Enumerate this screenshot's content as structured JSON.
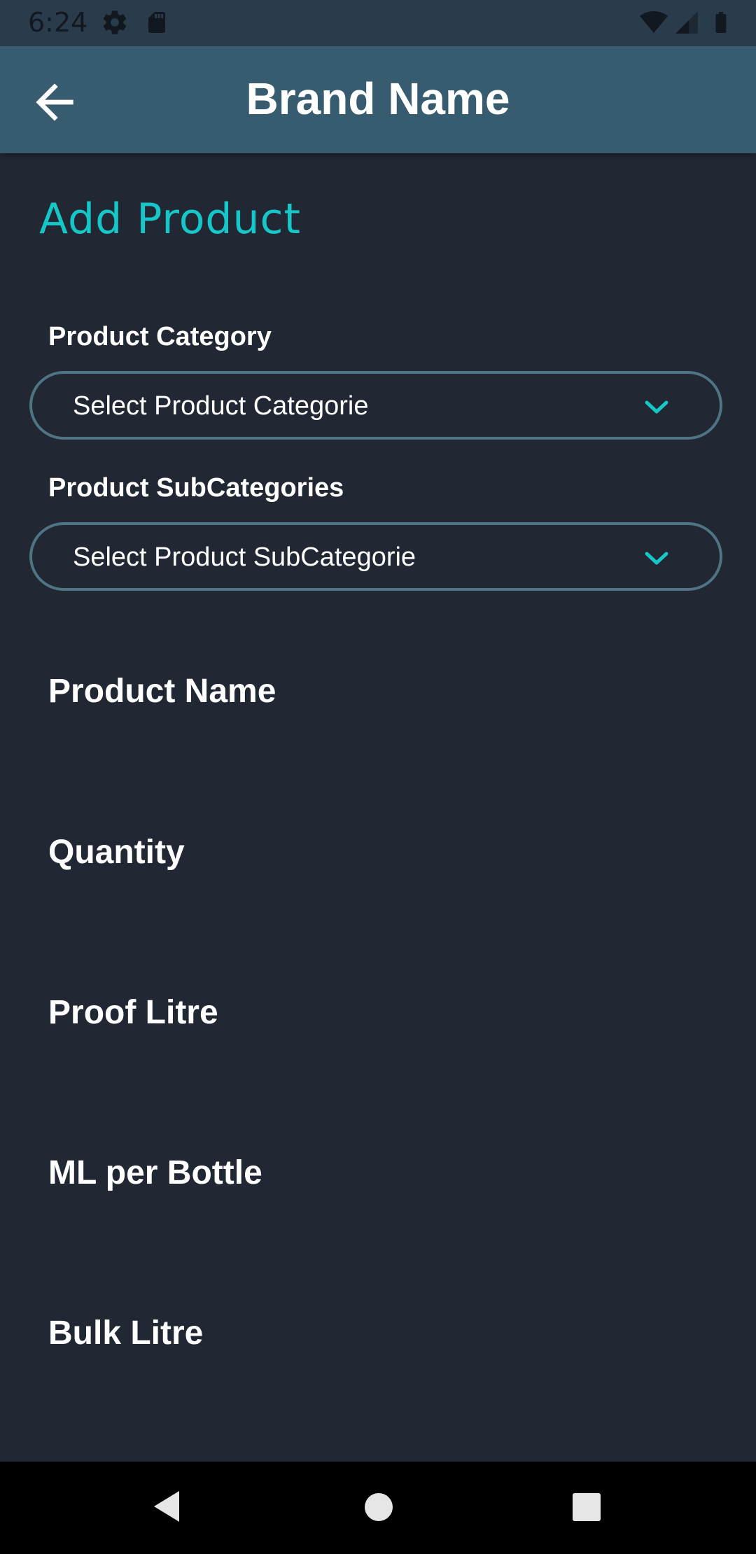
{
  "status_bar": {
    "time": "6:24",
    "icons": [
      "settings-icon",
      "sd-card-icon",
      "wifi-icon",
      "cell-signal-icon",
      "battery-icon"
    ]
  },
  "app_bar": {
    "title": "Brand Name",
    "back_icon": "arrow-back-icon",
    "color": "#375b6f"
  },
  "form": {
    "heading": "Add Product",
    "category": {
      "label": "Product Category",
      "value": "Select Product Categorie"
    },
    "subcategory": {
      "label": "Product SubCategories",
      "value": "Select Product SubCategorie"
    },
    "fields": {
      "product_name": "Product Name",
      "quantity": "Quantity",
      "proof_litre": "Proof Litre",
      "ml_per_bottle": "ML per Bottle",
      "bulk_litre": "Bulk Litre"
    }
  },
  "colors": {
    "accent": "#16c7c9",
    "background": "#222833",
    "select_border": "#4f7484"
  },
  "nav_bar": {
    "icons": [
      "back-triangle-icon",
      "home-circle-icon",
      "recents-square-icon"
    ]
  }
}
